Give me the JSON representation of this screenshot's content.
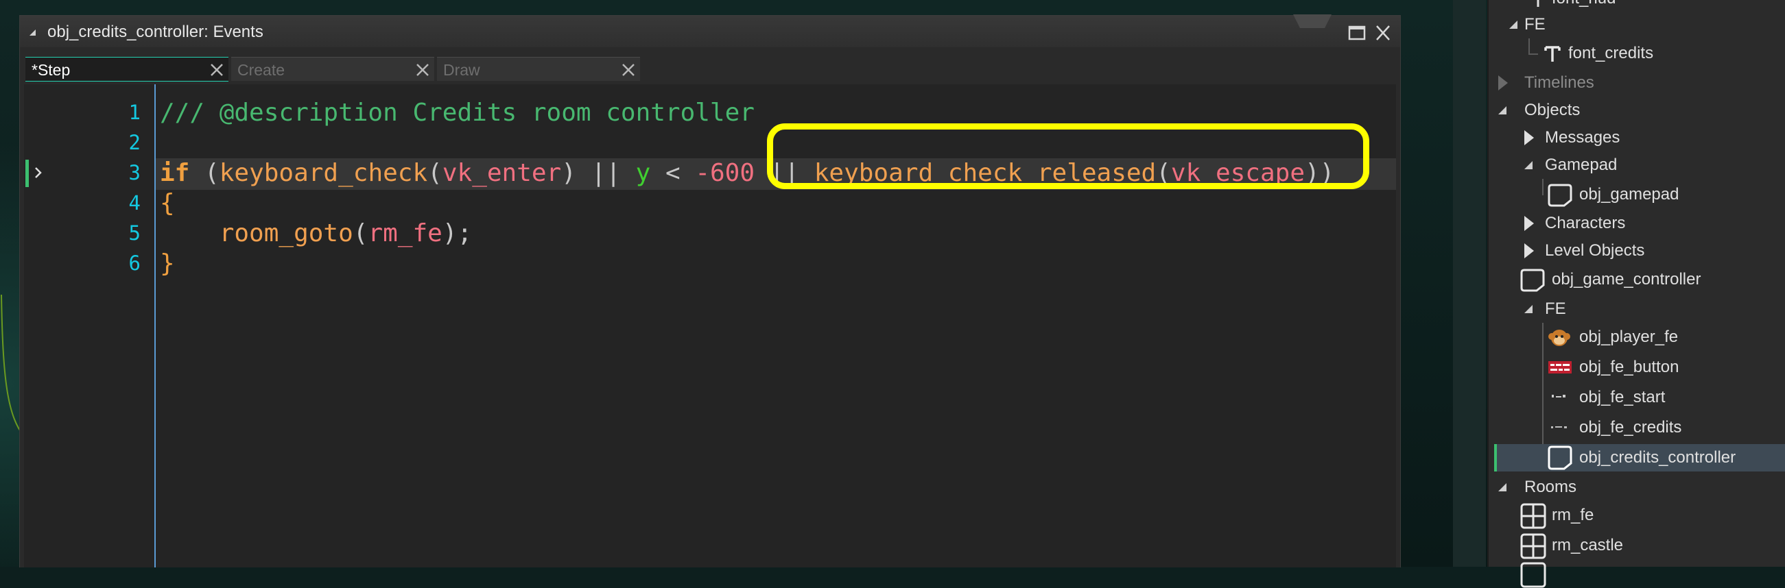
{
  "window": {
    "title": "obj_credits_controller: Events"
  },
  "tabs": [
    {
      "label": "*Step",
      "active": true
    },
    {
      "label": "Create",
      "active": false
    },
    {
      "label": "Draw",
      "active": false
    }
  ],
  "code": {
    "line_numbers": [
      "1",
      "2",
      "3",
      "4",
      "5",
      "6"
    ],
    "line1": "/// @description Credits room controller",
    "line3": {
      "kw": "if",
      "p1": " (",
      "fn1": "keyboard_check",
      "p2": "(",
      "c1": "vk_enter",
      "p3": ") || ",
      "v1": "y",
      "p4": " < ",
      "n1": "-600",
      "p5": " || ",
      "fn2": "keyboard_check_released",
      "p6": "(",
      "c2": "vk_escape",
      "p7": "))"
    },
    "line4": "{",
    "line5": {
      "indent": "    ",
      "fn": "room_goto",
      "p1": "(",
      "c": "rm_fe",
      "p2": ");"
    },
    "line6": "}"
  },
  "asset_tree": {
    "items": [
      {
        "label": "font_hud"
      },
      {
        "label": "FE"
      },
      {
        "label": "font_credits"
      },
      {
        "label": "Timelines"
      },
      {
        "label": "Objects"
      },
      {
        "label": "Messages"
      },
      {
        "label": "Gamepad"
      },
      {
        "label": "obj_gamepad"
      },
      {
        "label": "Characters"
      },
      {
        "label": "Level Objects"
      },
      {
        "label": "obj_game_controller"
      },
      {
        "label": "FE"
      },
      {
        "label": "obj_player_fe"
      },
      {
        "label": "obj_fe_button"
      },
      {
        "label": "obj_fe_start"
      },
      {
        "label": "obj_fe_credits"
      },
      {
        "label": "obj_credits_controller"
      },
      {
        "label": "Rooms"
      },
      {
        "label": "rm_fe"
      },
      {
        "label": "rm_castle"
      }
    ]
  },
  "colors": {
    "callout": "#ffff00",
    "selection": "#3e4a55",
    "line_number": "#14c8e0",
    "comment": "#48b870"
  }
}
